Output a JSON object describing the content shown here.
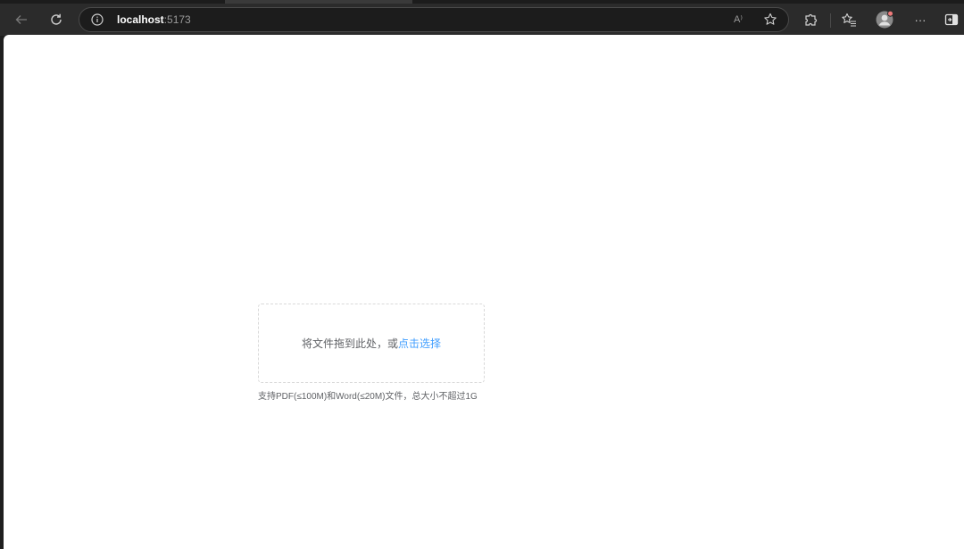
{
  "browser": {
    "url_host": "localhost",
    "url_port": ":5173",
    "read_aloud_label": "A⁾",
    "icons": {
      "back": "arrow-left-icon",
      "refresh": "refresh-icon",
      "site_info": "info-icon",
      "read_aloud": "read-aloud-icon",
      "favorite": "star-icon",
      "extensions": "puzzle-icon",
      "favorites_list": "favorites-icon",
      "profile": "avatar-icon",
      "more": "ellipsis-icon",
      "sidebar": "sidebar-icon"
    },
    "more_label": "···"
  },
  "upload": {
    "prompt": "将文件拖到此处，或",
    "link": "点击选择",
    "tip": "支持PDF(≤100M)和Word(≤20M)文件，总大小不超过1G"
  },
  "colors": {
    "link": "#409eff",
    "text": "#606266",
    "dashed_border": "#d9d9d9",
    "toolbar": "#2b2b2b"
  }
}
